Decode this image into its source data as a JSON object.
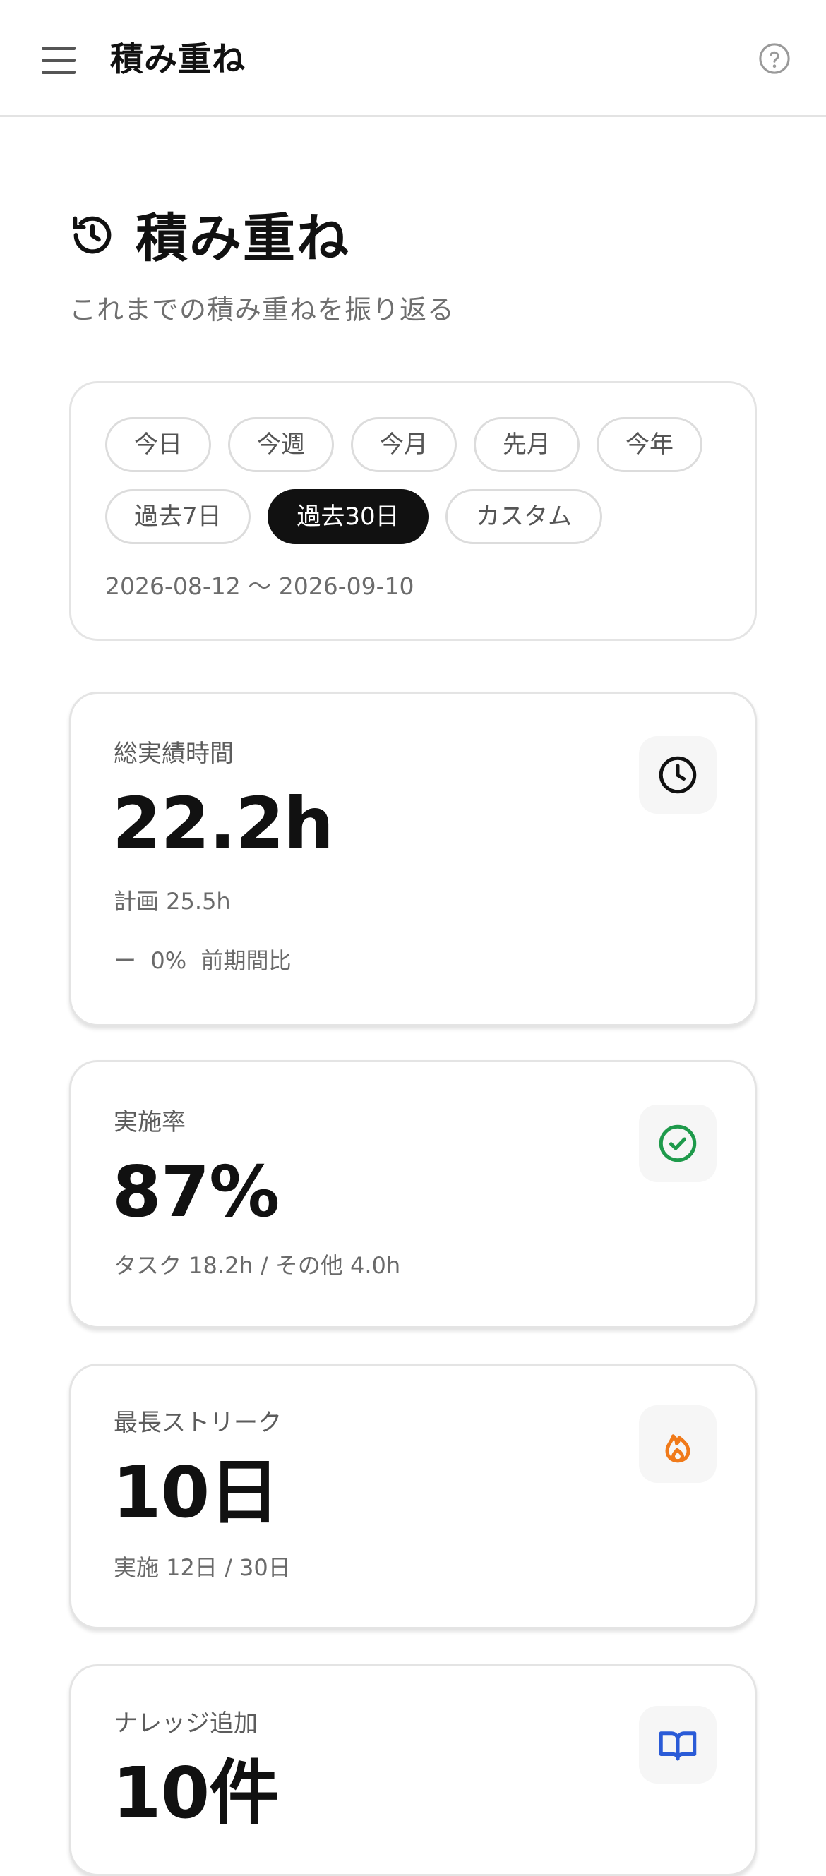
{
  "appbar": {
    "title": "積み重ね",
    "menu_icon": "menu-icon",
    "help_icon": "help-circle-icon"
  },
  "page": {
    "icon": "history-icon",
    "title": "積み重ね",
    "subtitle": "これまでの積み重ねを振り返る"
  },
  "filter": {
    "chips": [
      "今日",
      "今週",
      "今月",
      "先月",
      "今年",
      "過去7日",
      "過去30日",
      "カスタム"
    ],
    "selected": "過去30日",
    "range": "2026-08-12 〜 2026-09-10"
  },
  "stats": [
    {
      "label": "総実績時間",
      "value": "22.2h",
      "sub1": "計画 25.5h",
      "sub2": "ー  0%  前期間比",
      "icon": "clock-icon",
      "icon_color": "#111111"
    },
    {
      "label": "実施率",
      "value": "87%",
      "sub1": "タスク 18.2h / その他 4.0h",
      "icon": "check-circle-icon",
      "icon_color": "#1e9a4b"
    },
    {
      "label": "最長ストリーク",
      "value": "10日",
      "sub1": "実施 12日 / 30日",
      "icon": "flame-icon",
      "icon_color": "#f07a1a"
    },
    {
      "label": "ナレッジ追加",
      "value": "10件",
      "icon": "book-open-icon",
      "icon_color": "#2a5bd7"
    }
  ]
}
